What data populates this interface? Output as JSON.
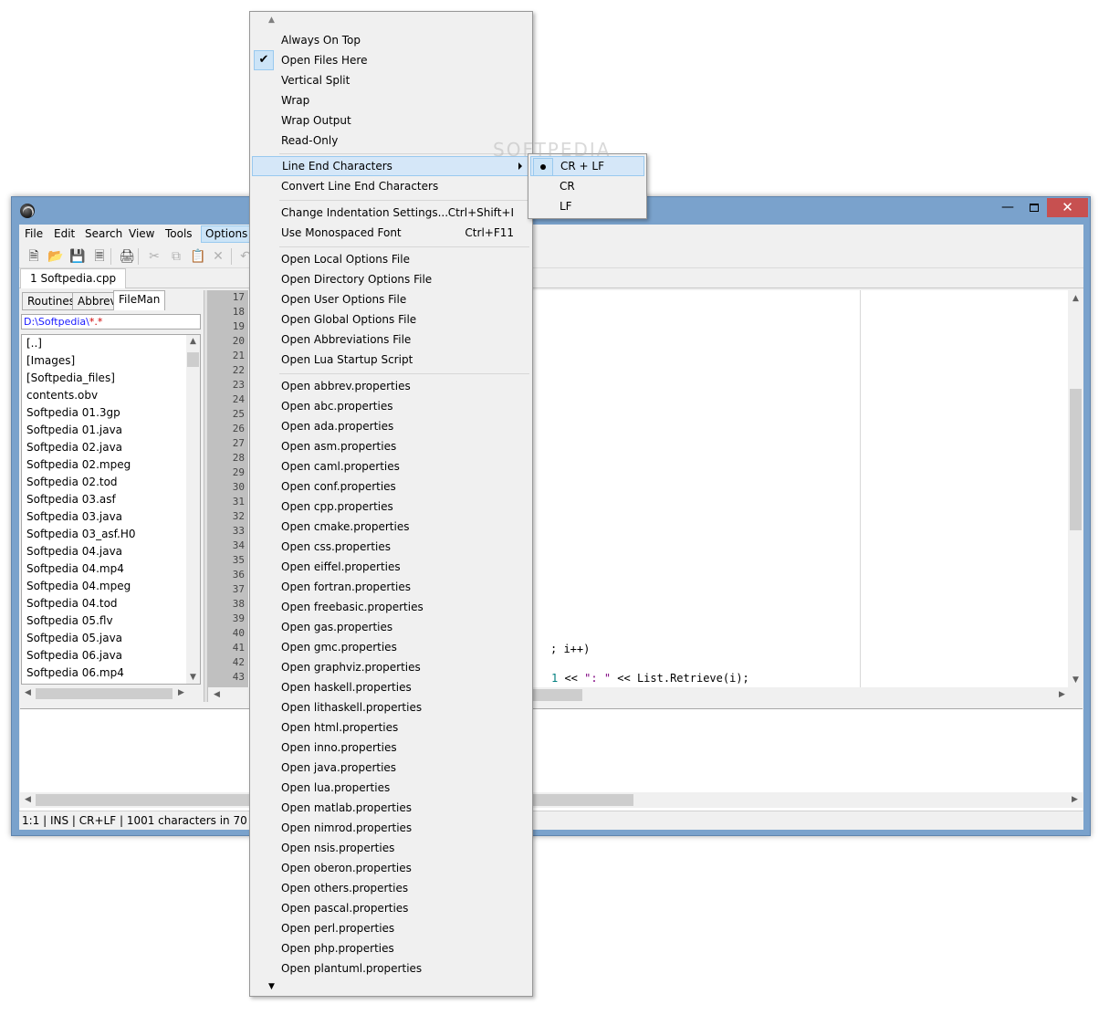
{
  "window": {
    "file_tab": "1 Softpedia.cpp",
    "minimize": "—",
    "close": "✕"
  },
  "menubar": [
    "File",
    "Edit",
    "Search",
    "View",
    "Tools",
    "Options"
  ],
  "side": {
    "tabs": [
      "Routines",
      "Abbrev",
      "FileMan"
    ],
    "path_prefix": "D:\\Softpedia\\",
    "path_filter": "*.*",
    "files": [
      "[..]",
      "[Images]",
      "[Softpedia_files]",
      "contents.obv",
      "Softpedia 01.3gp",
      "Softpedia 01.java",
      "Softpedia 02.java",
      "Softpedia 02.mpeg",
      "Softpedia 02.tod",
      "Softpedia 03.asf",
      "Softpedia 03.java",
      "Softpedia 03_asf.H0",
      "Softpedia 04.java",
      "Softpedia 04.mp4",
      "Softpedia 04.mpeg",
      "Softpedia 04.tod",
      "Softpedia 05.flv",
      "Softpedia 05.java",
      "Softpedia 06.java",
      "Softpedia 06.mp4"
    ]
  },
  "editor": {
    "line_numbers": [
      "17",
      "18",
      "19",
      "20",
      "21",
      "22",
      "23",
      "24",
      "25",
      "26",
      "27",
      "28",
      "29",
      "30",
      "31",
      "32",
      "33",
      "34",
      "35",
      "36",
      "37",
      "38",
      "39",
      "40",
      "41",
      "42",
      "43"
    ],
    "code_line_41": "; i++)",
    "code_line_43_num": "1",
    "code_line_43_a": " << ",
    "code_line_43_str": "\": \"",
    "code_line_43_b": " << List.Retrieve(i);"
  },
  "status": "1:1 | INS | CR+LF | 1001 characters in 70 lines | 0 c",
  "options_menu": {
    "group1": [
      "Always On Top",
      "Open Files Here",
      "Vertical Split",
      "Wrap",
      "Wrap Output",
      "Read-Only"
    ],
    "line_end": "Line End Characters",
    "convert": "Convert Line End Characters",
    "indent": "Change Indentation Settings...",
    "indent_accel": "Ctrl+Shift+I",
    "mono": "Use Monospaced Font",
    "mono_accel": "Ctrl+F11",
    "group3": [
      "Open Local Options File",
      "Open Directory Options File",
      "Open User Options File",
      "Open Global Options File",
      "Open Abbreviations File",
      "Open Lua Startup Script"
    ],
    "group4": [
      "Open abbrev.properties",
      "Open abc.properties",
      "Open ada.properties",
      "Open asm.properties",
      "Open caml.properties",
      "Open conf.properties",
      "Open cpp.properties",
      "Open cmake.properties",
      "Open css.properties",
      "Open eiffel.properties",
      "Open fortran.properties",
      "Open freebasic.properties",
      "Open gas.properties",
      "Open gmc.properties",
      "Open graphviz.properties",
      "Open haskell.properties",
      "Open lithaskell.properties",
      "Open html.properties",
      "Open inno.properties",
      "Open java.properties",
      "Open lua.properties",
      "Open matlab.properties",
      "Open nimrod.properties",
      "Open nsis.properties",
      "Open oberon.properties",
      "Open others.properties",
      "Open pascal.properties",
      "Open perl.properties",
      "Open php.properties",
      "Open plantuml.properties"
    ]
  },
  "line_end_submenu": [
    "CR + LF",
    "CR",
    "LF"
  ],
  "watermark": "SOFTPEDIA"
}
